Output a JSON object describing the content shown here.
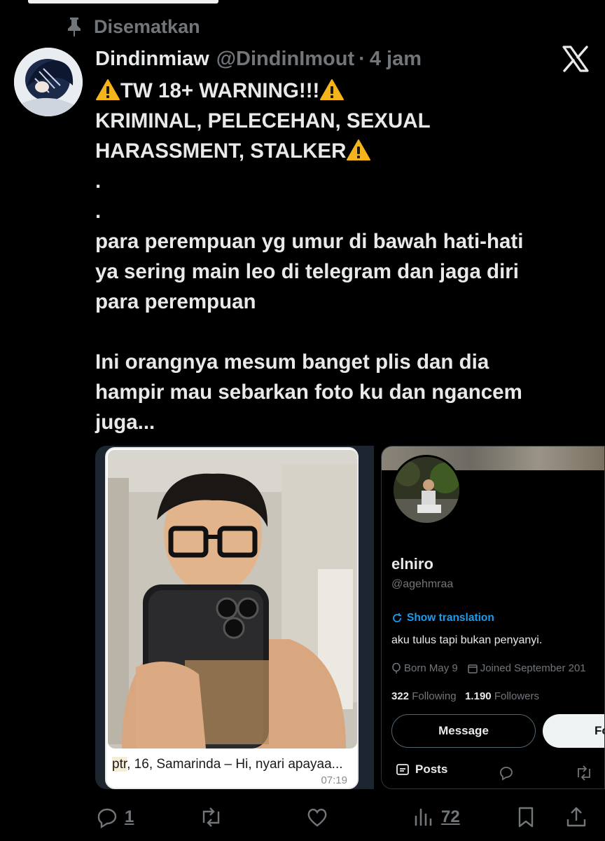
{
  "pinned": {
    "label": "Disematkan"
  },
  "tweet": {
    "display_name": "Dindinmiaw",
    "handle": "@DindinImout",
    "separator": "·",
    "time": "4 jam",
    "lines": [
      "TW 18+ WARNING!!!",
      "KRIMINAL, PELECEHAN, SEXUAL",
      "HARASSMENT, STALKER",
      ".",
      ".",
      "para perempuan yg umur di bawah hati-hati",
      "ya sering main leo di telegram dan jaga diri",
      "para perempuan",
      "",
      "Ini orangnya mesum banget plis dan dia",
      "hampir mau sebarkan foto ku dan ngancem",
      "juga..."
    ]
  },
  "media": {
    "left_card": {
      "caption_highlight": "ptr",
      "caption_rest": ", 16, Samarinda – Hi, nyari apayaa...",
      "caption_time": "07:19"
    },
    "profile": {
      "name": "elniro",
      "handle": "@agehmraa",
      "translate": "Show translation",
      "bio": "aku tulus tapi bukan penyanyi.",
      "born": "Born May 9",
      "joined": "Joined September 201",
      "following_count": "322",
      "following_label": "Following",
      "followers_count": "1.190",
      "followers_label": "Followers",
      "message_button": "Message",
      "follow_button": "Fo",
      "tab_posts": "Posts"
    }
  },
  "actions": {
    "replies": "1",
    "retweets": "",
    "likes": "",
    "views": "72"
  },
  "colors": {
    "background": "#000000",
    "text_primary": "#e7e9ea",
    "text_secondary": "#71767b",
    "link": "#1d9bf0",
    "warning": "#f5b41c"
  }
}
